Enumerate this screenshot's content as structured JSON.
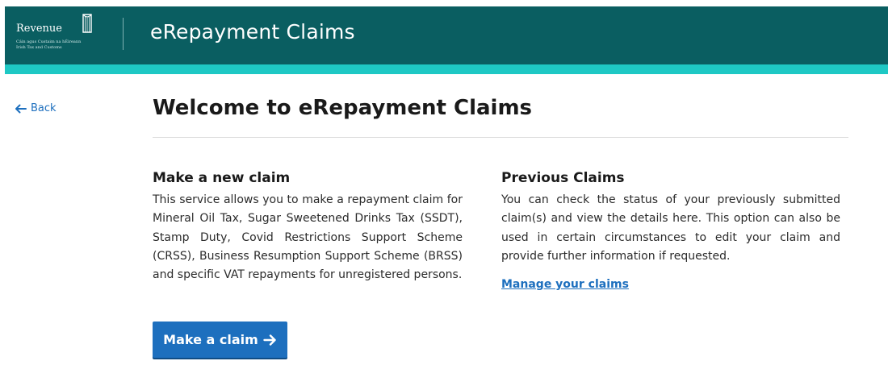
{
  "header": {
    "logo": {
      "wordmark": "Revenue",
      "subtitle_line1": "Cáin agus Custaim na hÉireann",
      "subtitle_line2": "Irish Tax and Customs"
    },
    "title": "eRepayment Claims",
    "background_color": "#0a5e61",
    "accent_color": "#1ec8c4"
  },
  "nav": {
    "back_label": "Back",
    "back_icon": "arrow-left-icon"
  },
  "main": {
    "title": "Welcome to eRepayment Claims",
    "new_claim": {
      "heading": "Make a new claim",
      "body": "This service allows you to make a repayment claim for Mineral Oil Tax, Sugar Sweetened Drinks Tax (SSDT), Stamp Duty, Covid Restrictions Support Scheme (CRSS), Business Resumption Support Scheme (BRSS) and specific VAT repayments for unregistered persons.",
      "button_label": "Make a claim",
      "button_icon": "arrow-right-icon",
      "button_color": "#1d6fbe"
    },
    "previous_claims": {
      "heading": "Previous Claims",
      "body": "You can check the status of your previously submitted claim(s) and view the details here. This option can also be used in certain circumstances to edit your claim and provide further information if requested.",
      "link_label": "Manage your claims",
      "link_color": "#1d6fbe"
    }
  }
}
